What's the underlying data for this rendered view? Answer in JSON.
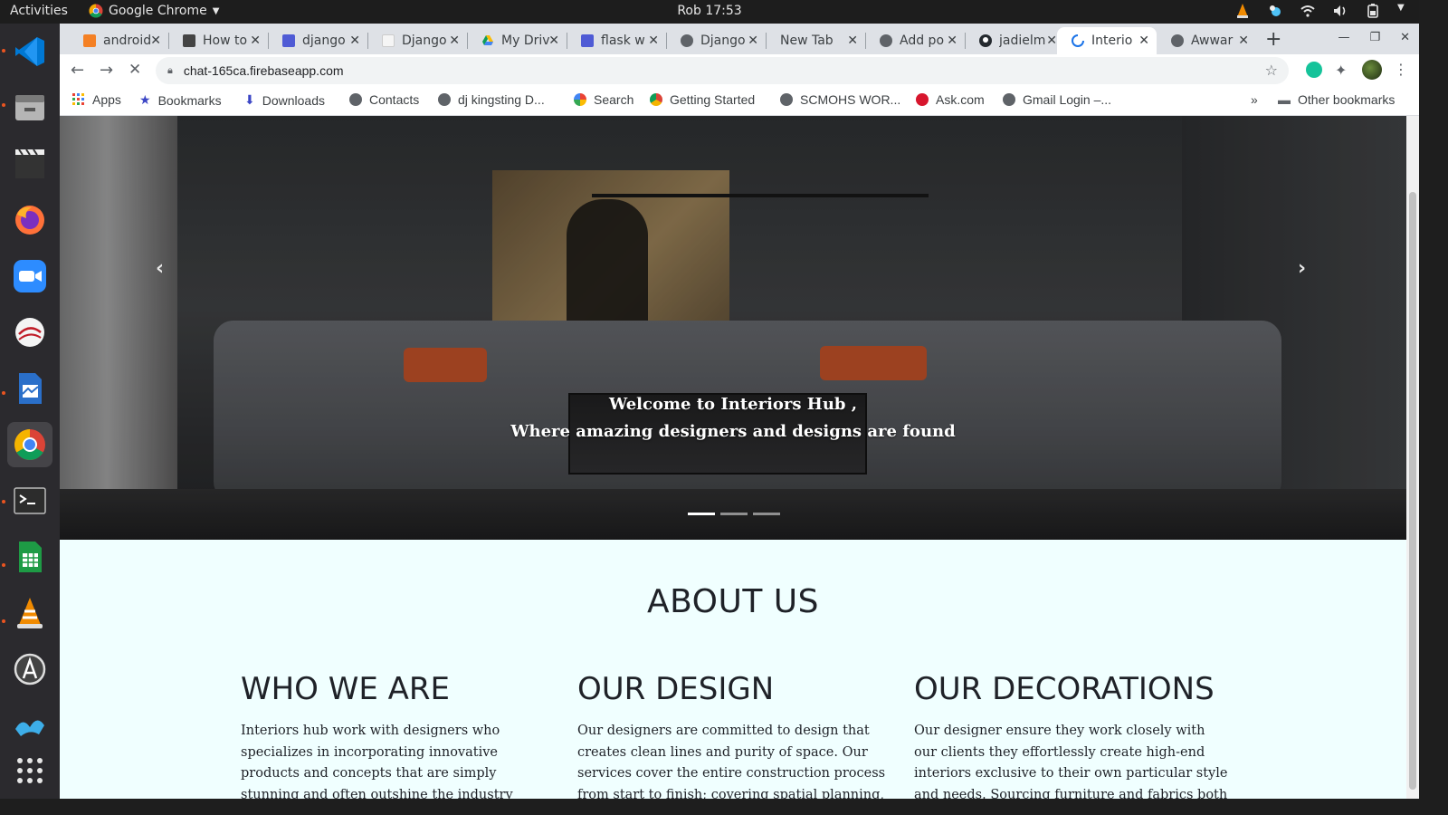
{
  "topbar": {
    "activities": "Activities",
    "app_name": "Google Chrome",
    "clock": "Rob 17:53"
  },
  "dock": {
    "items": [
      "vscode-icon",
      "files-icon",
      "video-editor-icon",
      "firefox-icon",
      "zoom-icon",
      "text-editor-icon",
      "writer-icon",
      "chrome-icon",
      "terminal-icon",
      "calc-icon",
      "vlc-icon",
      "software-updater-icon",
      "kde-connect-icon",
      "show-apps-icon"
    ]
  },
  "tabs": [
    {
      "title": "android",
      "active": false
    },
    {
      "title": "How to",
      "active": false
    },
    {
      "title": "django",
      "active": false
    },
    {
      "title": "Django",
      "active": false
    },
    {
      "title": "My Driv",
      "active": false
    },
    {
      "title": "flask w",
      "active": false
    },
    {
      "title": "Django",
      "active": false
    },
    {
      "title": "New Tab",
      "active": false
    },
    {
      "title": "Add po",
      "active": false
    },
    {
      "title": "jadielm",
      "active": false
    },
    {
      "title": "Interio",
      "active": true
    },
    {
      "title": "Awwar",
      "active": false
    }
  ],
  "omnibox": {
    "url": "chat-165ca.firebaseapp.com"
  },
  "bookmarks": {
    "items": [
      "Apps",
      "Bookmarks",
      "Downloads",
      "Contacts",
      "dj kingsting D...",
      "Search",
      "Getting Started",
      "SCMOHS WOR...",
      "Ask.com",
      "Gmail Login –..."
    ],
    "more": "»",
    "other": "Other bookmarks"
  },
  "hero": {
    "line1": "Welcome to Interiors Hub ,",
    "line2": "Where amazing designers and designs are found",
    "prev": "‹",
    "next": "›"
  },
  "about": {
    "title": "ABOUT US",
    "columns": [
      {
        "heading": "WHO WE ARE",
        "body": "Interiors hub work with designers who specializes in incorporating innovative products and concepts that are simply stunning and often outshine the industry standards."
      },
      {
        "heading": "OUR DESIGN",
        "body": "Our designers are committed to design that creates clean lines and purity of space. Our services cover the entire construction process from start to finish; covering spatial planning, electrical and lighting"
      },
      {
        "heading": "OUR DECORATIONS",
        "body": "Our designer ensure they work closely with our clients they effortlessly create high-end interiors exclusive to their own particular style and needs. Sourcing furniture and fabrics both locally and"
      }
    ]
  },
  "colors": {
    "page_bg": "#f0ffff",
    "text_dark": "#1f2228",
    "ubuntu_orange": "#e95420",
    "pillow": "#b24a25"
  }
}
